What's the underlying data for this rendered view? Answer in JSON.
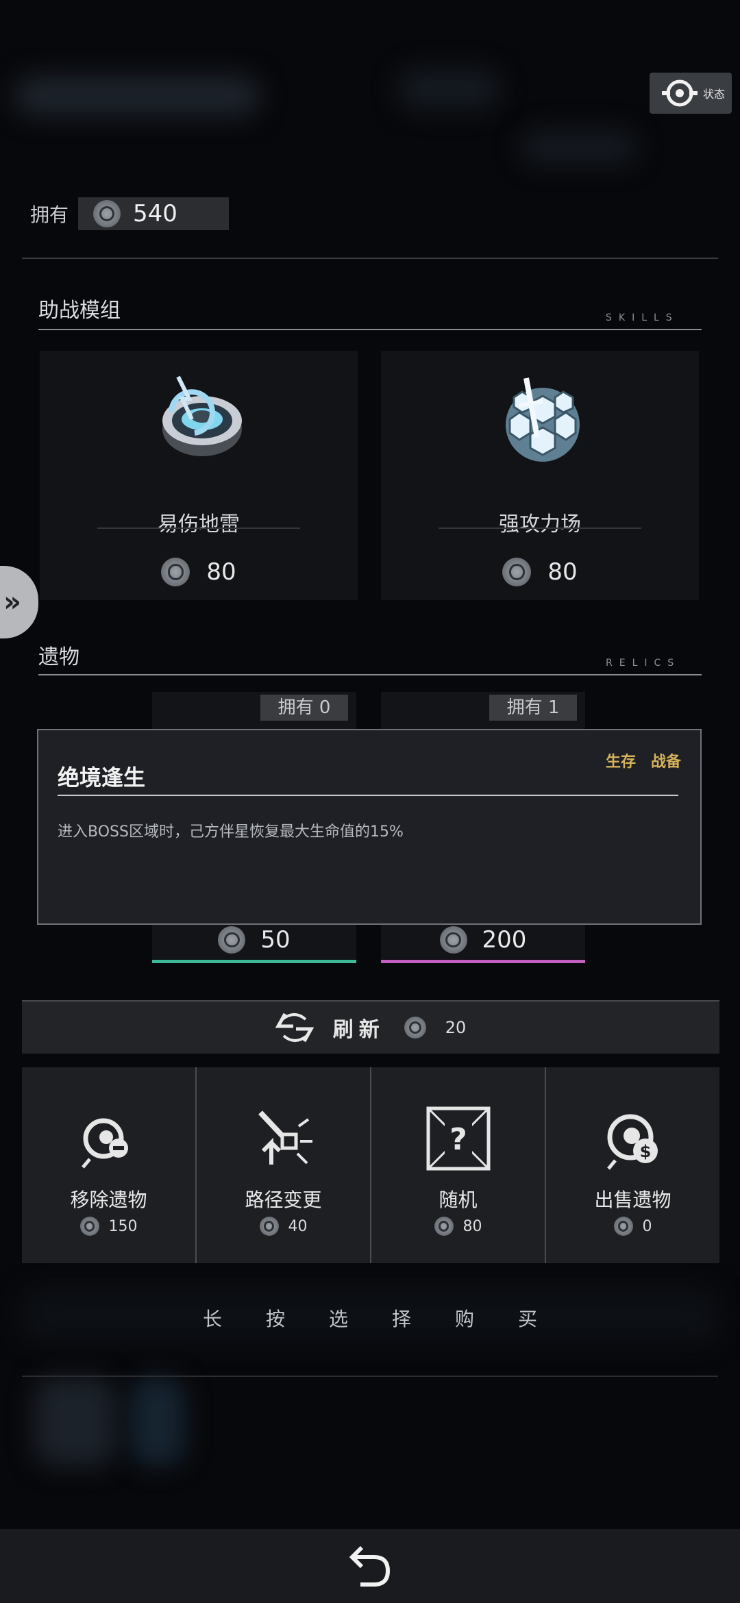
{
  "header": {
    "status_label": "状态"
  },
  "wallet": {
    "label": "拥有",
    "amount": "540"
  },
  "skills": {
    "title": "助战模组",
    "subtitle": "SKILLS",
    "items": [
      {
        "name": "易伤地雷",
        "price": "80",
        "icon": "mine-icon"
      },
      {
        "name": "强攻力场",
        "price": "80",
        "icon": "force-field-icon"
      }
    ]
  },
  "relics": {
    "title": "遗物",
    "subtitle": "RELICS",
    "items": [
      {
        "owned": "拥有 0",
        "price": "50",
        "accent": "#3fb89a"
      },
      {
        "owned": "拥有 1",
        "price": "200",
        "accent": "#c15fc1"
      }
    ]
  },
  "tooltip": {
    "title": "绝境逢生",
    "tags": [
      "生存",
      "战备"
    ],
    "description": "进入BOSS区域时，己方伴星恢复最大生命值的15%"
  },
  "refresh": {
    "label": "刷新",
    "cost": "20"
  },
  "actions": [
    {
      "label": "移除遗物",
      "price": "150",
      "icon": "remove-relic-icon"
    },
    {
      "label": "路径变更",
      "price": "40",
      "icon": "route-change-icon"
    },
    {
      "label": "随机",
      "price": "80",
      "icon": "random-icon"
    },
    {
      "label": "出售遗物",
      "price": "0",
      "icon": "sell-relic-icon"
    }
  ],
  "hint": "长按选择购买",
  "colors": {
    "tag": "#d7b25a",
    "relic_green": "#3fb89a",
    "relic_pink": "#c15fc1"
  }
}
